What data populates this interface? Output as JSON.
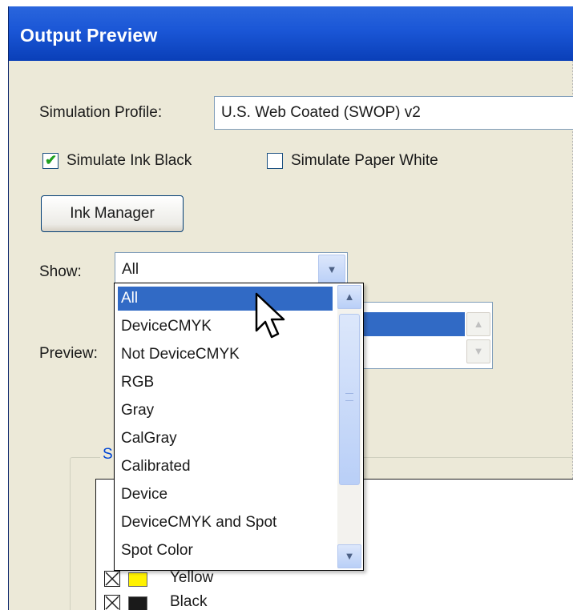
{
  "window": {
    "title": "Output Preview"
  },
  "simulation_profile": {
    "label": "Simulation Profile:",
    "value": "U.S. Web Coated (SWOP) v2"
  },
  "checkboxes": {
    "ink_black": {
      "label": "Simulate Ink Black",
      "checked": true
    },
    "paper_white": {
      "label": "Simulate Paper White",
      "checked": false
    }
  },
  "ink_manager_button": "Ink Manager",
  "show": {
    "label": "Show:",
    "value": "All"
  },
  "preview": {
    "label": "Preview:"
  },
  "group": {
    "title": "S"
  },
  "dropdown": {
    "options": [
      "All",
      "DeviceCMYK",
      "Not DeviceCMYK",
      "RGB",
      "Gray",
      "CalGray",
      "Calibrated",
      "Device",
      "DeviceCMYK and Spot",
      "Spot Color"
    ],
    "selected_index": 0
  },
  "inks": [
    {
      "name": "Yellow",
      "color": "#fff200"
    },
    {
      "name": "Black",
      "color": "#1a1a1a"
    }
  ],
  "colors": {
    "titlebar": "#1a56d6",
    "selection": "#316ac5",
    "dialog_bg": "#ece9d8"
  }
}
